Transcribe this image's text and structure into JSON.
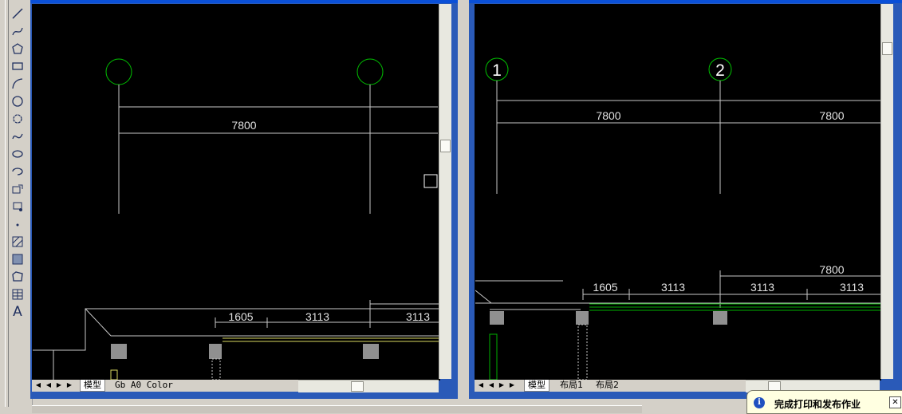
{
  "left_toolbar": {
    "tools": [
      "line-icon",
      "polyline-icon",
      "polygon-icon",
      "rectangle-icon",
      "arc-icon",
      "circle-icon",
      "revcloud-icon",
      "spline-icon",
      "ellipse-icon",
      "ellipse-arc-icon",
      "insert-block-icon",
      "make-block-icon",
      "point-icon",
      "hatch-icon",
      "gradient-icon",
      "region-icon",
      "table-icon",
      "text-icon"
    ],
    "text_tool_glyph": "A"
  },
  "left_window": {
    "tabs": [
      "模型",
      "Gb A0 Color"
    ],
    "dimensions": {
      "top": "7800",
      "seg1": "1605",
      "seg2": "3113",
      "seg3": "3113"
    }
  },
  "right_window": {
    "tabs": [
      "模型",
      "布局1",
      "布局2"
    ],
    "axis_labels": [
      "1",
      "2"
    ],
    "dimensions": {
      "top_a": "7800",
      "top_b": "7800",
      "mid": "7800",
      "seg1": "1605",
      "seg2": "3113",
      "seg3": "3113",
      "seg4": "3113"
    }
  },
  "notification": {
    "text": "完成打印和发布作业",
    "info_glyph": "i",
    "close_glyph": "✕"
  },
  "colors": {
    "canvas": "#000000",
    "axis_circle": "#00c000",
    "dim_line": "#c8c8c8",
    "wall_green": "#00b000",
    "wall_yellow": "#d8d860"
  }
}
